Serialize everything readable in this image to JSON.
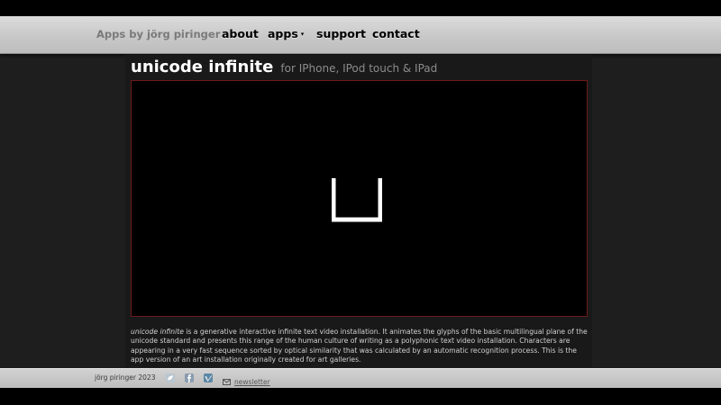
{
  "nav": {
    "brand": "Apps by jörg piringer",
    "links": [
      {
        "label": "about"
      },
      {
        "label": "apps",
        "caret": "▾"
      },
      {
        "label": "support"
      },
      {
        "label": "contact"
      }
    ]
  },
  "main": {
    "title": "unicode infinite",
    "subtitle": "for IPhone, IPod touch & IPad",
    "video": {
      "current_glyph": "⊔"
    },
    "description": {
      "emphasis": "unicode infinite",
      "text": " is a generative interactive infinite text video installation. It animates the glyphs of the basic multilingual plane of the unicode standard and presents this range of the human culture of writing as a polyphonic text video installation. Characters are appearing in a very fast sequence sorted by optical similarity that was calculated by an automatic recognition process. This is the app version of an art installation originally created for art galleries."
    }
  },
  "footer": {
    "copyright": "jörg piringer 2023",
    "icons": [
      "twitter-icon",
      "facebook-icon",
      "vimeo-icon",
      "mail-icon"
    ],
    "newsletter": "newsletter"
  }
}
